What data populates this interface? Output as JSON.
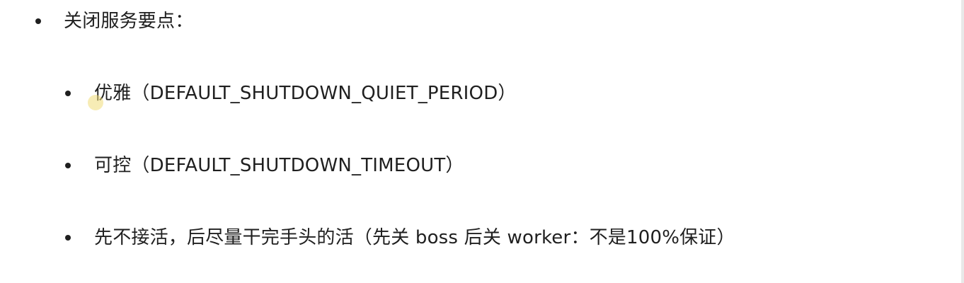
{
  "document": {
    "heading": "关闭服务要点：",
    "items": [
      {
        "text": "优雅（DEFAULT_SHUTDOWN_QUIET_PERIOD）"
      },
      {
        "text": "可控（DEFAULT_SHUTDOWN_TIMEOUT）"
      },
      {
        "text": "先不接活，后尽量干完手头的活（先关 boss 后关 worker：不是100%保证）"
      }
    ]
  }
}
